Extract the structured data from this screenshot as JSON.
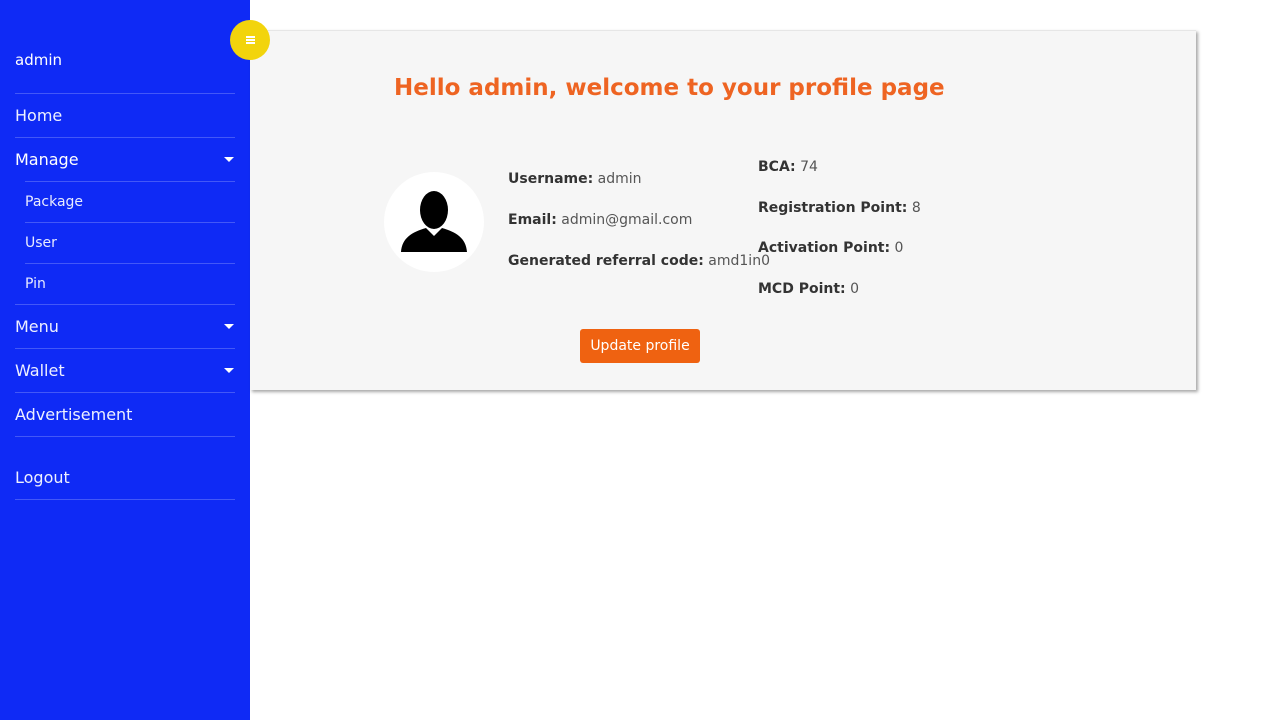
{
  "sidebar": {
    "username": "admin",
    "items": {
      "home": "Home",
      "manage": "Manage",
      "package": "Package",
      "user": "User",
      "pin": "Pin",
      "menu": "Menu",
      "wallet": "Wallet",
      "advertisement": "Advertisement",
      "logout": "Logout"
    }
  },
  "toggle": {
    "icon": "menu-icon",
    "color": "#f2d40c"
  },
  "profile": {
    "title": "Hello admin, welcome to your profile page",
    "username_label": "Username:",
    "username_value": "admin",
    "email_label": "Email:",
    "email_value": "admin@gmail.com",
    "referral_label": "Generated referral code:",
    "referral_value": "amd1in0",
    "bca_label": "BCA:",
    "bca_value": "74",
    "registration_label": "Registration Point:",
    "registration_value": "8",
    "activation_label": "Activation Point:",
    "activation_value": "0",
    "mcd_label": "MCD Point:",
    "mcd_value": "0",
    "update_button": "Update profile"
  },
  "colors": {
    "sidebar": "#0f2af5",
    "accent": "#ee6422",
    "button": "#ef6211"
  }
}
